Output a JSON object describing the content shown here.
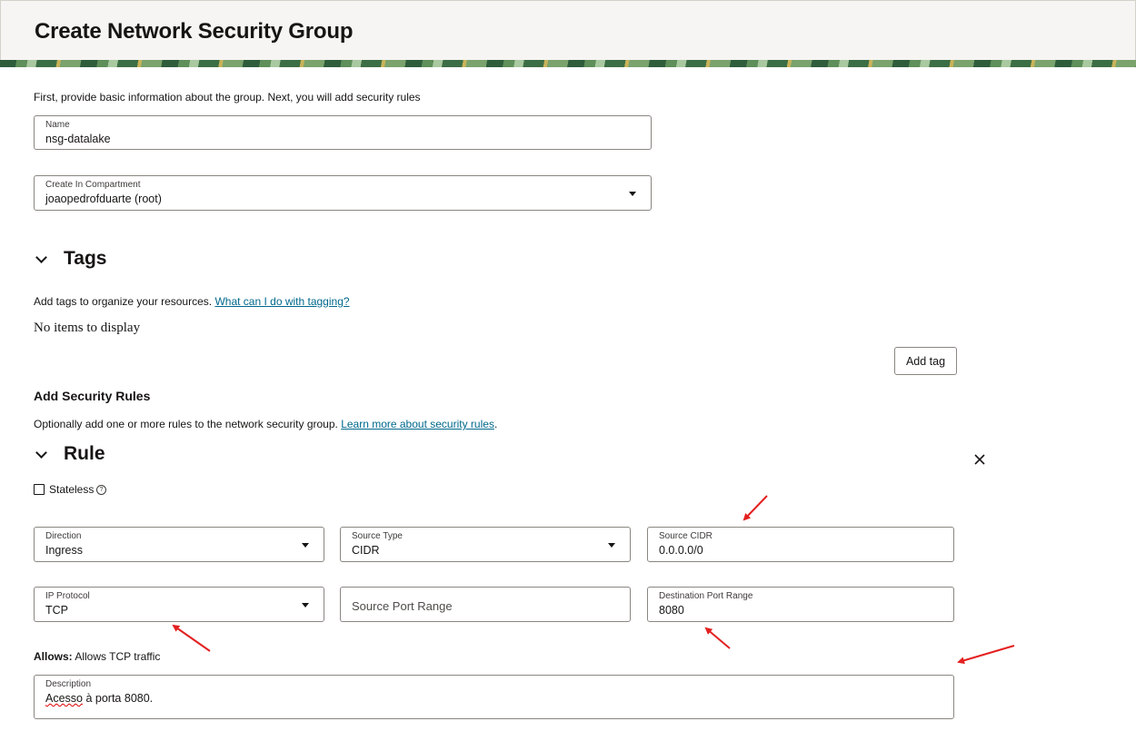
{
  "header": {
    "title": "Create Network Security Group"
  },
  "intro": "First, provide basic information about the group. Next, you will add security rules",
  "name_field": {
    "label": "Name",
    "value": "nsg-datalake"
  },
  "compartment_field": {
    "label": "Create In Compartment",
    "value": "joaopedrofduarte (root)"
  },
  "tags": {
    "title": "Tags",
    "description": "Add tags to organize your resources.",
    "help_link": "What can I do with tagging?",
    "empty_text": "No items to display",
    "add_button": "Add tag"
  },
  "security_rules": {
    "title": "Add Security Rules",
    "description": "Optionally add one or more rules to the network security group.",
    "help_link": "Learn more about security rules",
    "period": "."
  },
  "rule": {
    "title": "Rule",
    "stateless_label": "Stateless",
    "help_glyph": "?",
    "direction": {
      "label": "Direction",
      "value": "Ingress"
    },
    "source_type": {
      "label": "Source Type",
      "value": "CIDR"
    },
    "source_cidr": {
      "label": "Source CIDR",
      "value": "0.0.0.0/0"
    },
    "ip_protocol": {
      "label": "IP Protocol",
      "value": "TCP"
    },
    "source_port_range": {
      "placeholder": "Source Port Range"
    },
    "destination_port_range": {
      "label": "Destination Port Range",
      "value": "8080"
    },
    "allows_label": "Allows:",
    "allows_value": "Allows TCP traffic",
    "description": {
      "label": "Description",
      "value_word1": "Acesso",
      "value_rest": " à porta 8080."
    }
  },
  "colors": {
    "link": "#00688c",
    "annotation_arrow": "#e32020",
    "header_bg": "#f6f5f3"
  },
  "icons": {
    "section_toggle": "chevron-down-icon",
    "close": "close-icon",
    "dropdown": "caret-down-icon",
    "help": "help-circle-icon"
  }
}
